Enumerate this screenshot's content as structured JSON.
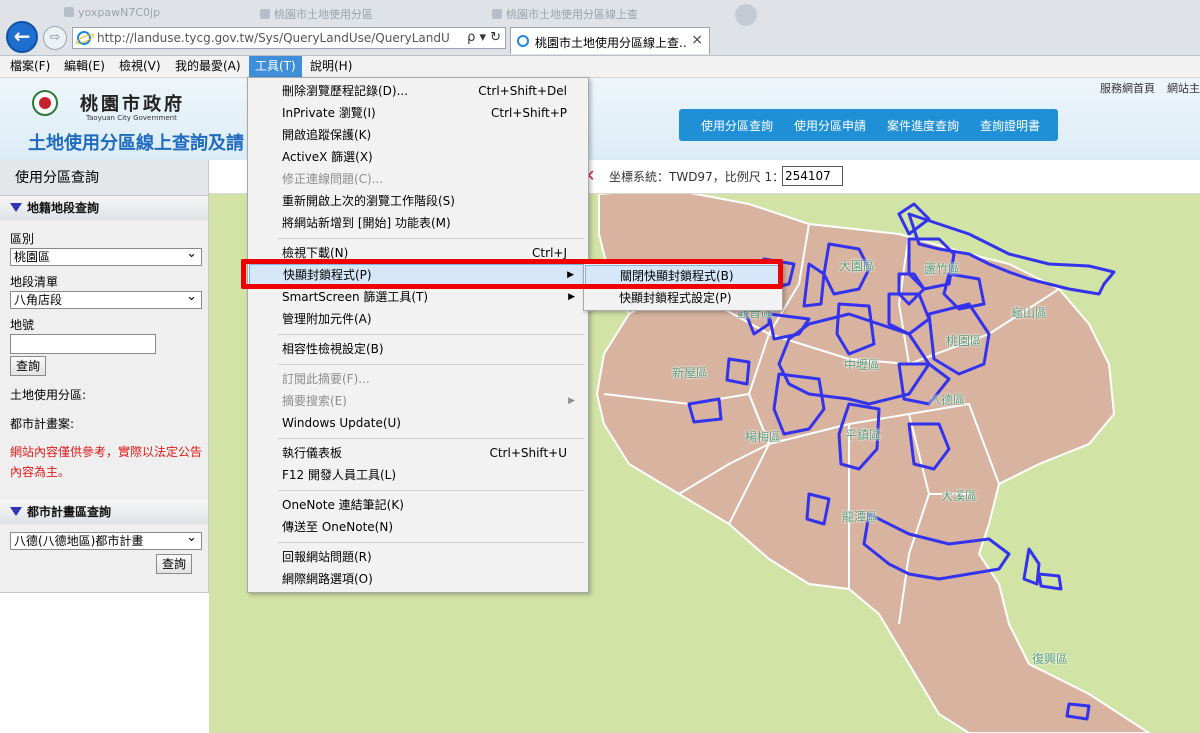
{
  "browser": {
    "ghost_tabs": [
      "yoxpawN7C0jp",
      "桃園市土地使用分區",
      "桃園市土地使用分區線上查"
    ],
    "back_label": "←",
    "forward_label": "⇨",
    "address_url": "http://landuse.tycg.gov.tw/Sys/QueryLandUse/QueryLandUse.a",
    "address_tools": "ρ ▾ ↻",
    "tab_title": "桃園市土地使用分區線上查...",
    "tab_close": "×"
  },
  "menubar": [
    "檔案(F)",
    "編輯(E)",
    "檢視(V)",
    "我的最愛(A)",
    "工具(T)",
    "說明(H)"
  ],
  "header": {
    "org_name": "桃園市政府",
    "org_name_en": "Taoyuan City Government",
    "site_title": "土地使用分區線上查詢及",
    "site_title_tail": "請",
    "top_links": [
      "服務網首頁",
      "網站主"
    ],
    "nav": [
      "使用分區查詢",
      "使用分區申請",
      "案件進度查詢",
      "查詢證明書"
    ]
  },
  "sidebar": {
    "title": "使用分區查詢",
    "cadastral_heading": "地籍地段查詢",
    "district_label": "區別",
    "district_value": "桃園區",
    "section_label": "地段清單",
    "section_value": "八角店段",
    "lot_label": "地號",
    "query_button": "查詢",
    "landuse_label": "土地使用分區:",
    "urbanplan_label": "都市計畫案:",
    "disclaimer": "網站內容僅供參考，實際以法定公告內容為主。",
    "urban_heading": "都市計畫區查詢",
    "urban_value": "八德(八德地區)都市計畫",
    "urban_query_button": "查詢"
  },
  "coordbar": {
    "fragment": "環",
    "text": "坐標系統：TWD97，比例尺 1：",
    "scale_value": "254107"
  },
  "map": {
    "district_labels": [
      "大園區",
      "蘆竹區",
      "龜山區",
      "觀音區",
      "新屋區",
      "中壢區",
      "桃園區",
      "八德區",
      "楊梅區",
      "平鎮區",
      "大溪區",
      "龍潭區",
      "復興區"
    ],
    "land_color": "#d8b3a0",
    "outside_color": "#d2e3a6",
    "overlay_color": "#3333ee"
  },
  "tools_menu": {
    "items": [
      {
        "label": "刪除瀏覽歷程記錄(D)...",
        "shortcut": "Ctrl+Shift+Del"
      },
      {
        "label": "InPrivate 瀏覽(I)",
        "shortcut": "Ctrl+Shift+P"
      },
      {
        "label": "開啟追蹤保護(K)",
        "shortcut": ""
      },
      {
        "label": "ActiveX 篩選(X)",
        "shortcut": ""
      },
      {
        "label": "修正連線問題(C)...",
        "shortcut": ""
      },
      {
        "label": "重新開啟上次的瀏覽工作階段(S)",
        "shortcut": ""
      },
      {
        "label": "將網站新增到 [開始] 功能表(M)",
        "shortcut": ""
      },
      {
        "label": "檢視下載(N)",
        "shortcut": "Ctrl+J"
      },
      {
        "label": "快顯封鎖程式(P)",
        "shortcut": ""
      },
      {
        "label": "SmartScreen 篩選工具(T)",
        "shortcut": ""
      },
      {
        "label": "管理附加元件(A)",
        "shortcut": ""
      },
      {
        "label": "相容性檢視設定(B)",
        "shortcut": ""
      },
      {
        "label": "訂閱此摘要(F)...",
        "shortcut": ""
      },
      {
        "label": "摘要搜索(E)",
        "shortcut": ""
      },
      {
        "label": "Windows Update(U)",
        "shortcut": ""
      },
      {
        "label": "執行儀表板",
        "shortcut": "Ctrl+Shift+U"
      },
      {
        "label": "F12 開發人員工具(L)",
        "shortcut": ""
      },
      {
        "label": "OneNote 連結筆記(K)",
        "shortcut": ""
      },
      {
        "label": "傳送至 OneNote(N)",
        "shortcut": ""
      },
      {
        "label": "回報網站問題(R)",
        "shortcut": ""
      },
      {
        "label": "網際網路選項(O)",
        "shortcut": ""
      }
    ],
    "submenu_arrow": "▶"
  },
  "popup_submenu": {
    "items": [
      "關閉快顯封鎖程式(B)",
      "快顯封鎖程式設定(P)"
    ]
  }
}
